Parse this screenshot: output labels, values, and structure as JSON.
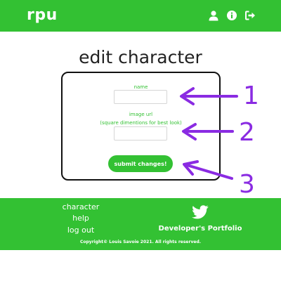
{
  "navbar": {
    "brand": "rpu",
    "icons": [
      "user-icon",
      "info-icon",
      "sign-out-icon"
    ]
  },
  "page": {
    "title": "edit character"
  },
  "form": {
    "name_label": "name",
    "name_value": "",
    "image_label_line1": "image url",
    "image_label_line2": "(square dimentions for best look)",
    "image_value": "",
    "submit_label": "submit changes!"
  },
  "annotations": {
    "markers": [
      "1",
      "2",
      "3"
    ],
    "color": "#8a2be2"
  },
  "footer": {
    "links": [
      "character",
      "help",
      "log out"
    ],
    "portfolio_label": "Developer's Portfolio",
    "copyright": "Copyright© Louis Savoie 2021. All rights reserved.",
    "social_icon": "twitter-icon"
  },
  "colors": {
    "accent": "#33c133",
    "text_dark": "#222222",
    "annotation": "#8a2be2"
  }
}
